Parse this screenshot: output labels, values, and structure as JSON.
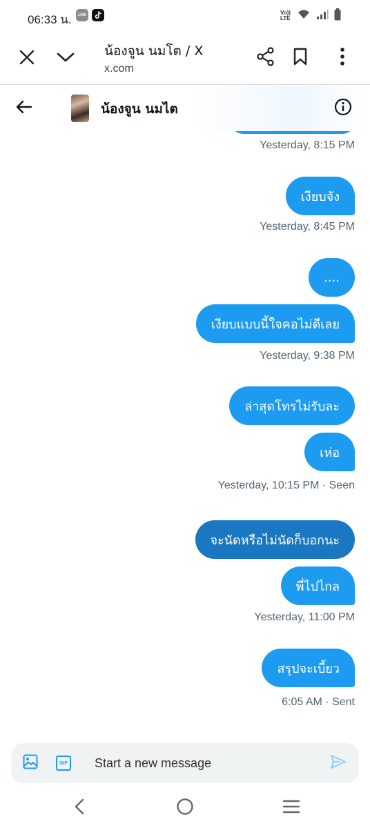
{
  "status_bar": {
    "time": "06:33 น.",
    "line_label": "LINE",
    "network_label": "Vo)) LTE"
  },
  "browser": {
    "page_title": "น้องจูน นมโต / X",
    "url": "x.com"
  },
  "conversation": {
    "contact_name": "น้องจูน นมไต"
  },
  "messages": [
    {
      "type": "meta",
      "text": "Yesterday, 8:15 PM"
    },
    {
      "type": "bubble",
      "text": "เงียบจัง"
    },
    {
      "type": "meta",
      "text": "Yesterday, 8:45 PM"
    },
    {
      "type": "bubble",
      "text": "...."
    },
    {
      "type": "bubble",
      "text": "เงียบแบบนี้ใจคอไม่ดีเลย"
    },
    {
      "type": "meta",
      "text": "Yesterday, 9:38 PM"
    },
    {
      "type": "bubble",
      "text": "ล่าสุดโทรไม่รับละ"
    },
    {
      "type": "bubble",
      "text": "เห่อ"
    },
    {
      "type": "meta",
      "text": "Yesterday, 10:15 PM · Seen"
    },
    {
      "type": "bubble",
      "text": "จะนัดหรือไม่นัดก็บอกนะ",
      "selected": true
    },
    {
      "type": "bubble",
      "text": "พี่ไปไกล"
    },
    {
      "type": "meta",
      "text": "Yesterday, 11:00 PM"
    },
    {
      "type": "bubble",
      "text": "สรุปจะเบี้ยว"
    },
    {
      "type": "meta",
      "text": "6:05 AM · Sent"
    }
  ],
  "composer": {
    "placeholder": "Start a new message",
    "gif_label": "GIF"
  },
  "colors": {
    "bubble": "#1d9bf0",
    "bubble_selected": "#1a77c2",
    "meta_text": "#536471",
    "composer_bg": "#eff3f4",
    "accent": "#1d9bf0"
  },
  "icons": {
    "browser": [
      "close-icon",
      "chevron-down-icon",
      "share-icon",
      "bookmark-icon",
      "more-vertical-icon"
    ],
    "header": [
      "back-arrow-icon",
      "info-icon"
    ],
    "composer": [
      "image-icon",
      "gif-icon",
      "send-icon"
    ],
    "nav": [
      "nav-back-icon",
      "nav-home-icon",
      "nav-recents-icon"
    ]
  }
}
